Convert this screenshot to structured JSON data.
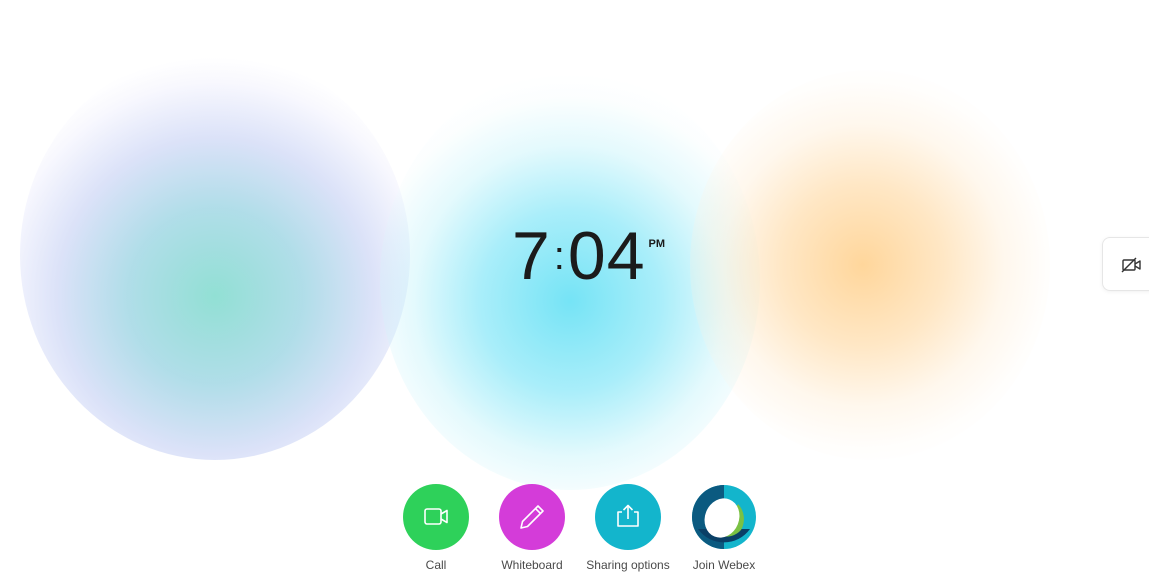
{
  "clock": {
    "hour": "7",
    "separator": ":",
    "minutes": "04",
    "ampm": "PM"
  },
  "side_panel": {
    "icon": "camera-off-icon"
  },
  "actions": [
    {
      "label": "Call",
      "icon": "video-camera-icon",
      "color": "#2ed15a"
    },
    {
      "label": "Whiteboard",
      "icon": "pencil-icon",
      "color": "#d43cd9"
    },
    {
      "label": "Sharing options",
      "icon": "share-tray-icon",
      "color": "#13b5cc"
    },
    {
      "label": "Join Webex",
      "icon": "webex-logo-icon",
      "colors": [
        "#13b5cc",
        "#0a4f72",
        "#7ac143"
      ]
    }
  ],
  "background": {
    "blob_colors": [
      "#8cded2",
      "#6ee2f5",
      "#ffd496"
    ]
  }
}
